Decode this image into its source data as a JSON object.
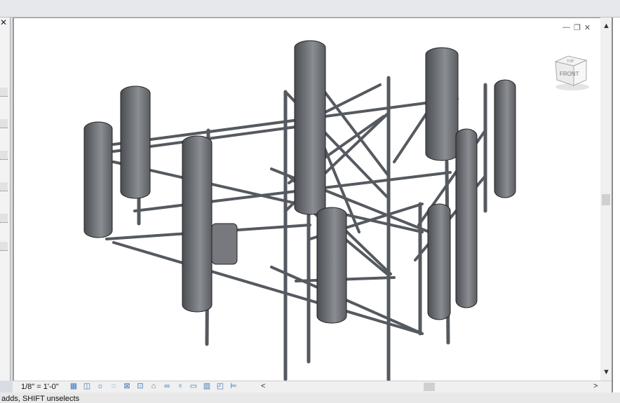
{
  "view": {
    "scale": "1/8\" = 1'-0\"",
    "viewcube_face": "FRONT",
    "viewcube_top": "TOP",
    "window_controls": {
      "minimize": "—",
      "restore": "❐",
      "close": "✕"
    }
  },
  "scrollbars": {
    "up": "▲",
    "down": "▼",
    "left": "<",
    "right": ">"
  },
  "left_panel": {
    "close": "✕"
  },
  "view_control_icons": [
    "detail-level-icon",
    "visual-style-icon",
    "sun-path-icon",
    "shadows-icon",
    "crop-view-icon",
    "show-crop-icon",
    "unlock-3d-view-icon",
    "temporary-hide-icon",
    "reveal-hidden-icon",
    "temporary-view-properties-icon",
    "analytical-model-icon",
    "highlight-displacement-icon",
    "constraints-icon"
  ],
  "view_control_glyphs": [
    "▦",
    "◫",
    "☼",
    "◌",
    "⊠",
    "⊡",
    "⌂",
    "∞",
    "♀",
    "▭",
    "▥",
    "◰",
    "⊨"
  ],
  "status_bar": {
    "text": "adds, SHIFT unselects"
  },
  "colors": {
    "steel": "#555a60",
    "antenna": "#6c6f74"
  }
}
